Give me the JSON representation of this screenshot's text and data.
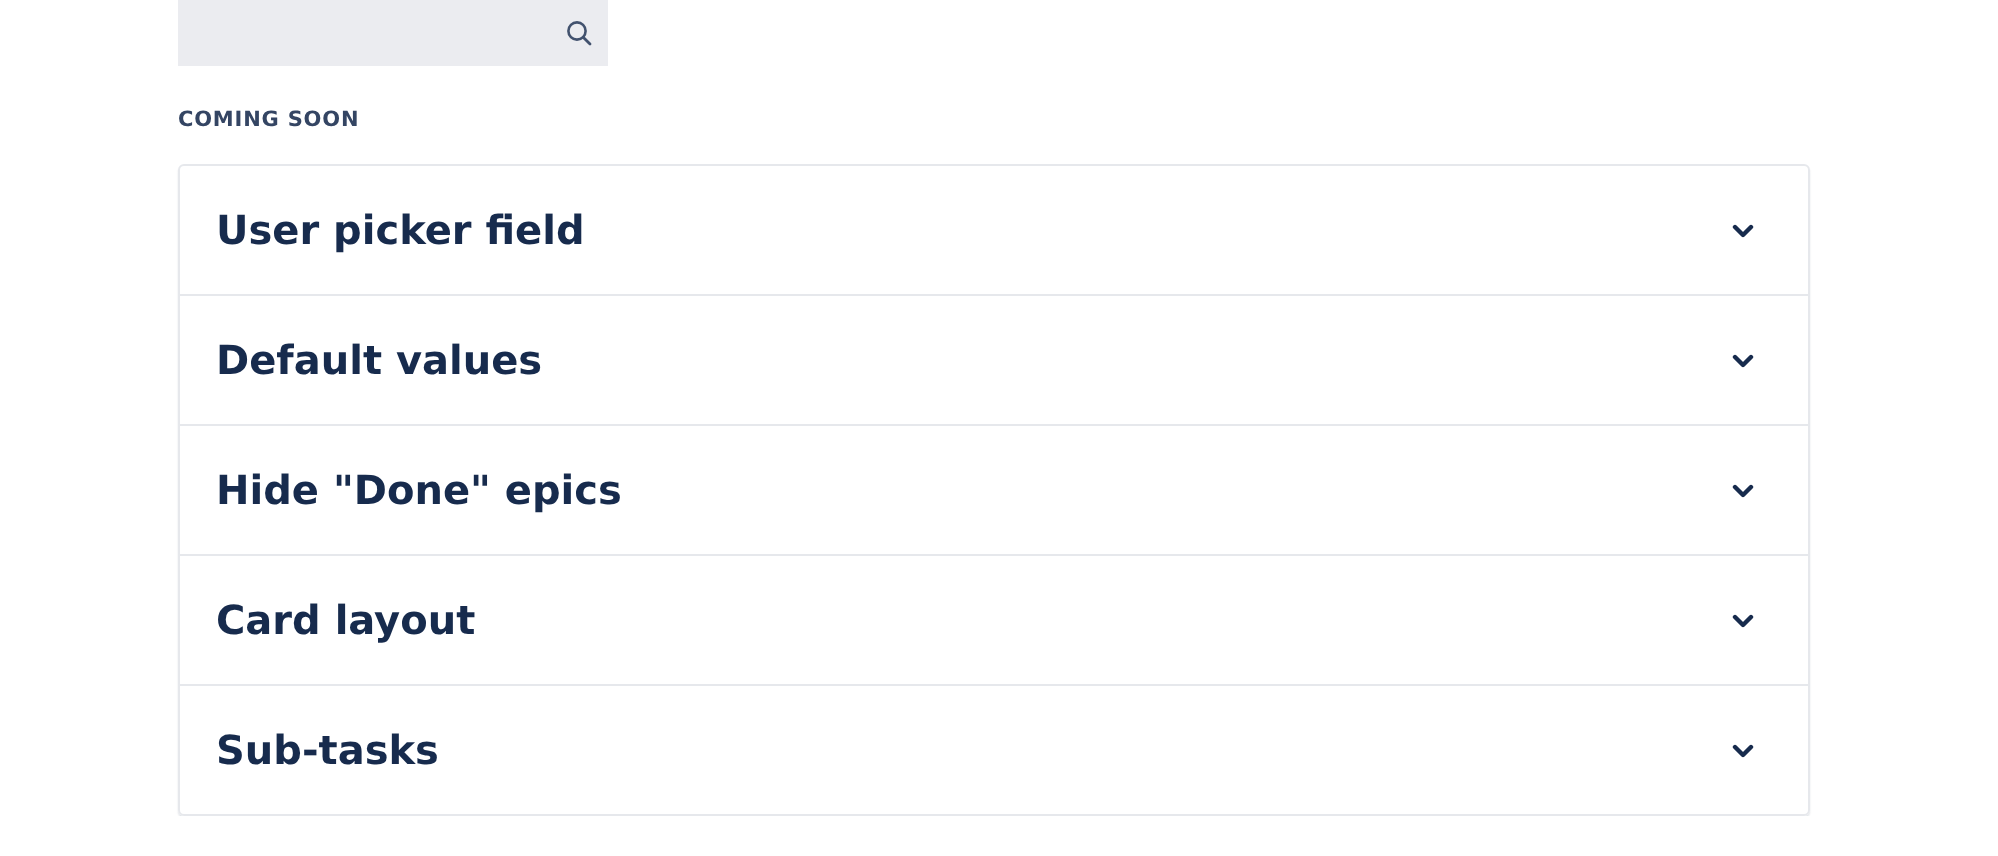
{
  "section": {
    "heading": "COMING SOON"
  },
  "panels": [
    {
      "title": "User picker field",
      "expanded": false
    },
    {
      "title": "Default values",
      "expanded": false
    },
    {
      "title": "Hide \"Done\" epics",
      "expanded": false
    },
    {
      "title": "Card layout",
      "expanded": false
    },
    {
      "title": "Sub-tasks",
      "expanded": false
    }
  ]
}
